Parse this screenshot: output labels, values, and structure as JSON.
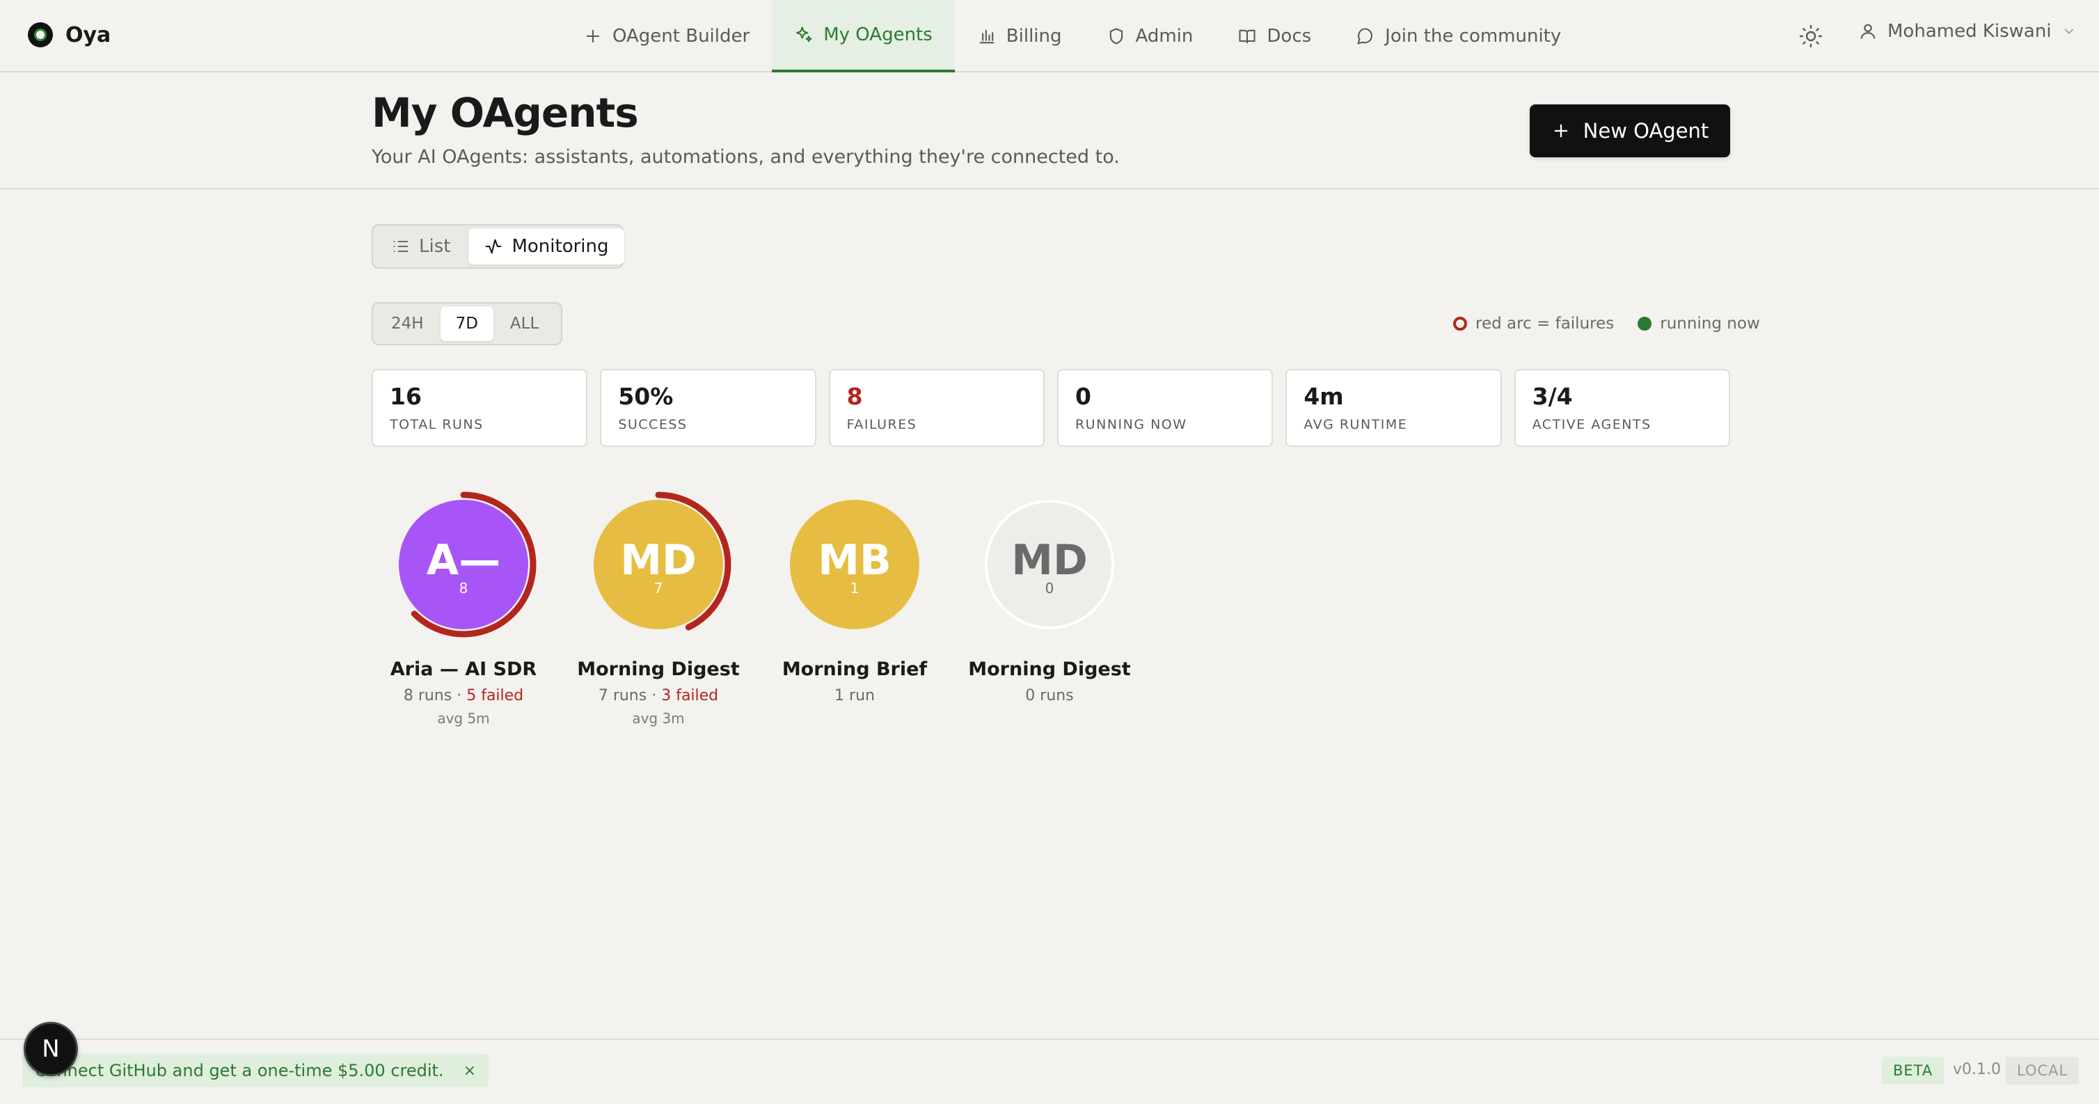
{
  "app": {
    "name": "Oya"
  },
  "nav": {
    "items": [
      {
        "label": "OAgent Builder",
        "icon": "plus-icon"
      },
      {
        "label": "My OAgents",
        "icon": "sparkles-icon",
        "active": true
      },
      {
        "label": "Billing",
        "icon": "bar-chart-icon"
      },
      {
        "label": "Admin",
        "icon": "shield-icon"
      },
      {
        "label": "Docs",
        "icon": "book-icon"
      },
      {
        "label": "Join the community",
        "icon": "chat-bubble-icon"
      }
    ]
  },
  "user": {
    "name": "Mohamed Kiswani"
  },
  "page": {
    "title": "My OAgents",
    "subtitle": "Your AI OAgents: assistants, automations, and everything they're connected to.",
    "new_button": "New OAgent"
  },
  "view_toggle": {
    "list": "List",
    "monitoring": "Monitoring",
    "selected": "Monitoring"
  },
  "range_toggle": {
    "options": [
      "24H",
      "7D",
      "ALL"
    ],
    "selected": "7D"
  },
  "legend": {
    "failures": "red arc = failures",
    "running": "running now"
  },
  "stats": [
    {
      "value": "16",
      "label": "TOTAL RUNS"
    },
    {
      "value": "50%",
      "label": "SUCCESS"
    },
    {
      "value": "8",
      "label": "FAILURES"
    },
    {
      "value": "0",
      "label": "RUNNING NOW"
    },
    {
      "value": "4m",
      "label": "AVG RUNTIME"
    },
    {
      "value": "3/4",
      "label": "ACTIVE AGENTS"
    }
  ],
  "agents": [
    {
      "initials": "A—",
      "count": "8",
      "name": "Aria — AI SDR",
      "runs": "8 runs",
      "sep": " · ",
      "failed": "5 failed",
      "avg": "avg 5m",
      "failure_fraction": 0.625,
      "color": "#a855f7"
    },
    {
      "initials": "MD",
      "count": "7",
      "name": "Morning Digest",
      "runs": "7 runs",
      "sep": " · ",
      "failed": "3 failed",
      "avg": "avg 3m",
      "failure_fraction": 0.4286,
      "color": "#e6bd42"
    },
    {
      "initials": "MB",
      "count": "1",
      "name": "Morning Brief",
      "runs": "1 run",
      "failure_fraction": 0,
      "color": "#e6bd42"
    },
    {
      "initials": "MD",
      "count": "0",
      "name": "Morning Digest",
      "runs": "0 runs",
      "failure_fraction": 0,
      "color": "#efede9"
    }
  ],
  "colors": {
    "accent": "#2c7a2f",
    "failure": "#b3261e",
    "background": "#f4f2ee"
  },
  "footer": {
    "promo": "Connect GitHub and get a one-time $5.00 credit.",
    "promo_close": "×",
    "badge": "N",
    "beta": "BETA",
    "version": "v0.1.0",
    "local": "LOCAL"
  }
}
